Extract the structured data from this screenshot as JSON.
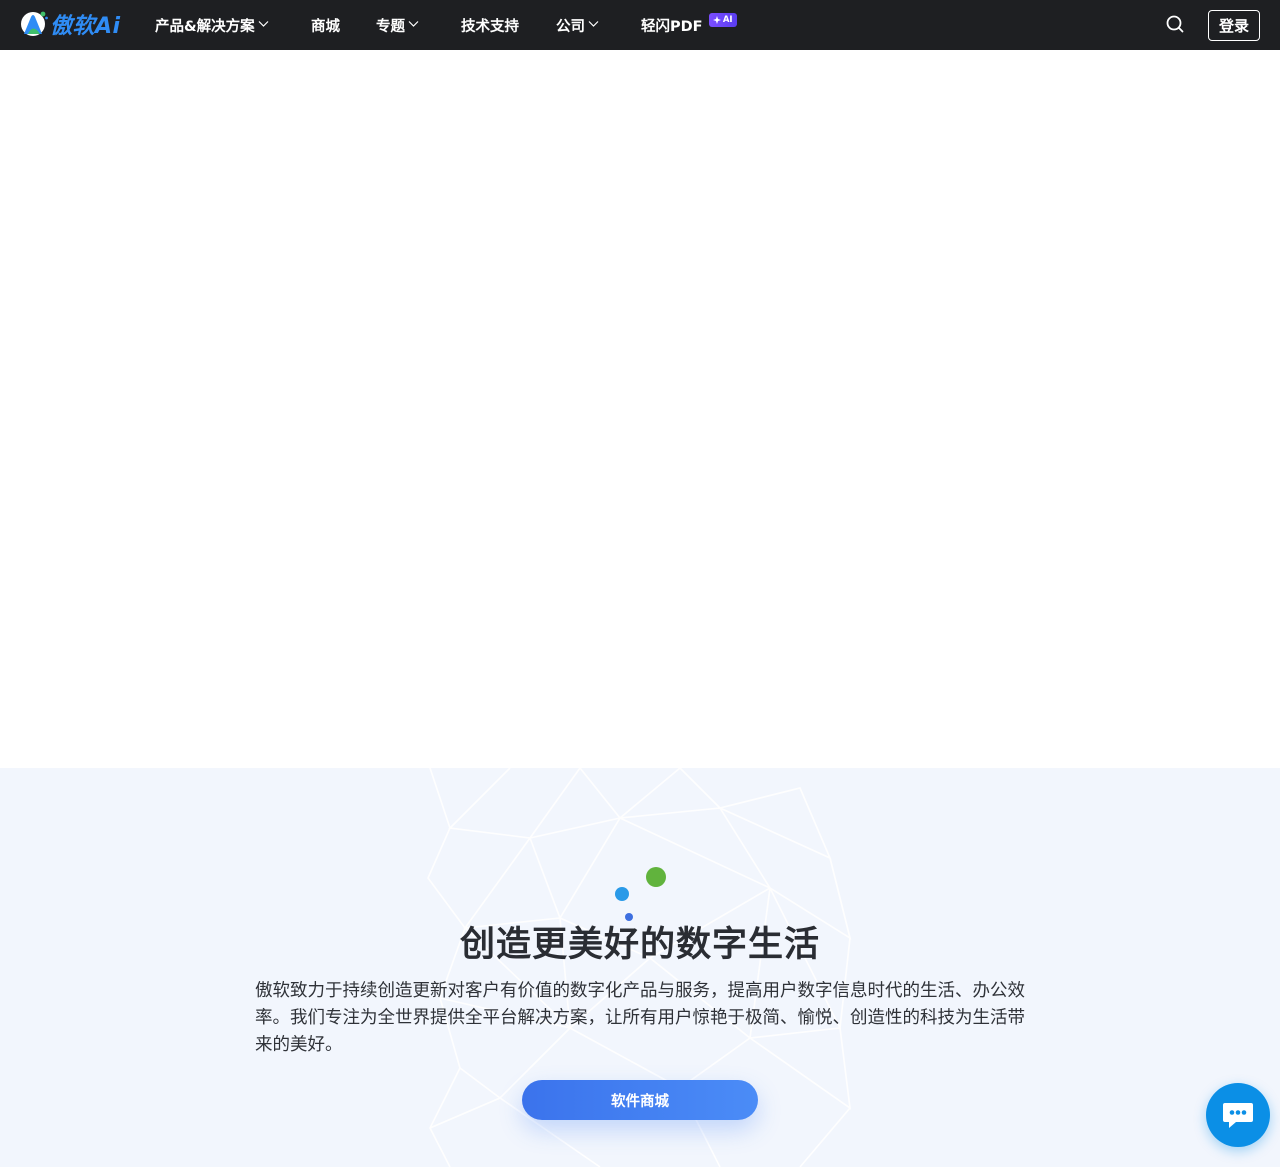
{
  "brand": {
    "name": "傲软Ai",
    "accent_color": "#2f8cf5",
    "logo_icon": "aoruan-logo-icon"
  },
  "nav": {
    "items": [
      {
        "label": "产品&解决方案",
        "has_dropdown": true
      },
      {
        "label": "商城",
        "has_dropdown": false
      },
      {
        "label": "专题",
        "has_dropdown": true
      },
      {
        "label": "技术支持",
        "has_dropdown": false
      },
      {
        "label": "公司",
        "has_dropdown": true
      },
      {
        "label": "轻闪PDF",
        "has_dropdown": false,
        "badge": "AI"
      }
    ],
    "search_icon": "search-icon",
    "login_label": "登录"
  },
  "about": {
    "title": "创造更美好的数字生活",
    "description": "傲软致力于持续创造更新对客户有价值的数字化产品与服务，提高用户数字信息时代的生活、办公效率。我们专注为全世界提供全平台解决方案，让所有用户惊艳于极简、愉悦、创造性的科技为生活带来的美好。",
    "cta_label": "软件商城",
    "background_color": "#f2f6fd",
    "button_color": "#3b73ec"
  },
  "chat": {
    "icon": "chat-bubble-icon",
    "color": "#0b8fe6"
  }
}
